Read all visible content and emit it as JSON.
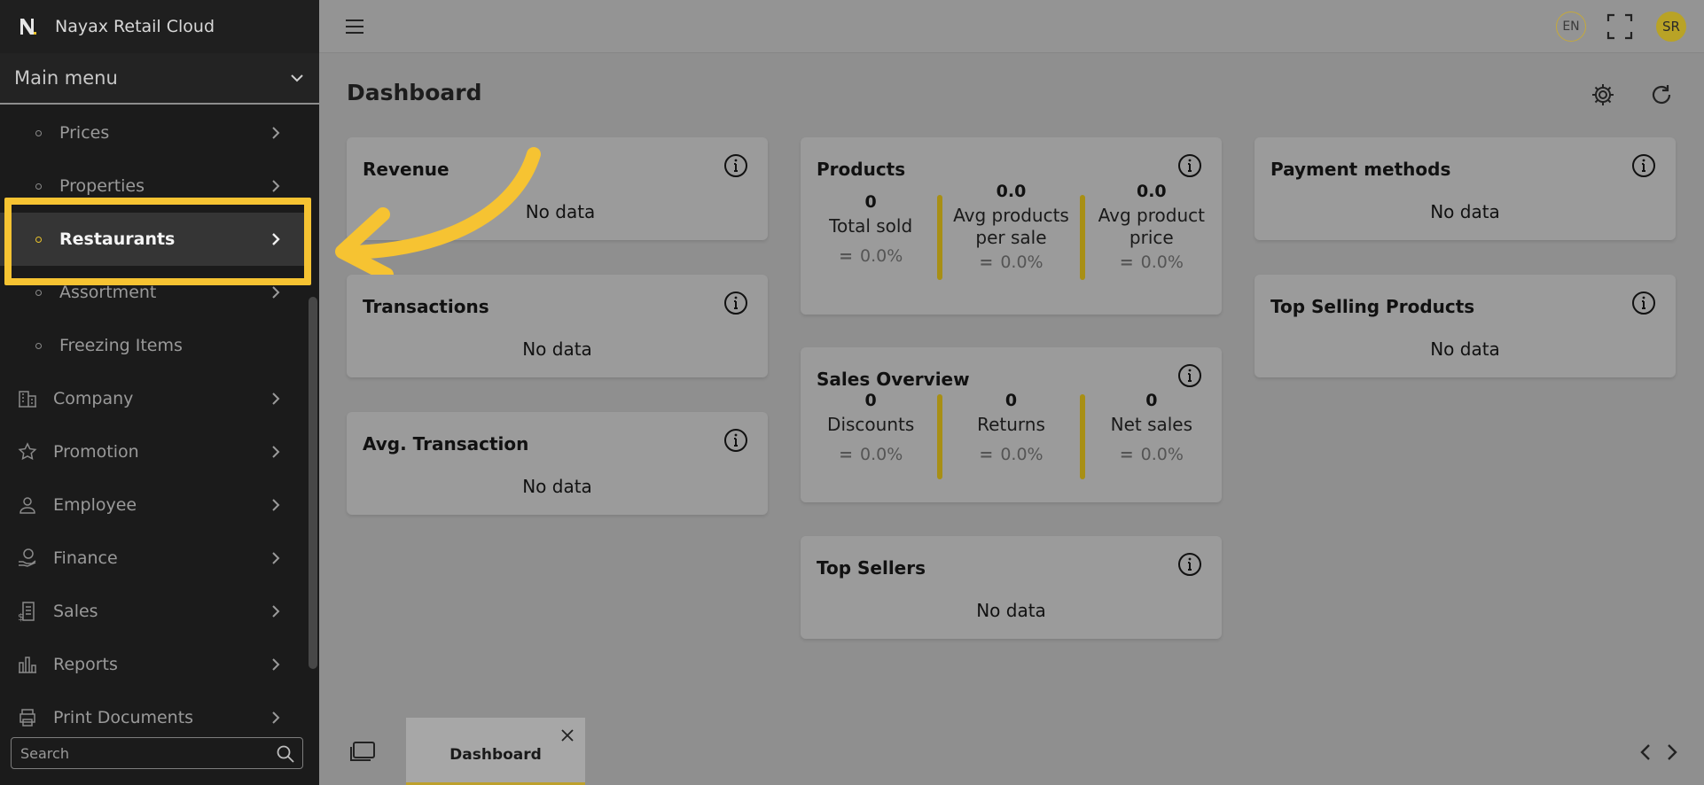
{
  "app": {
    "title": "Nayax Retail Cloud"
  },
  "sidebar": {
    "main_menu_label": "Main menu",
    "items": [
      {
        "label": "Prices",
        "kind": "sub"
      },
      {
        "label": "Properties",
        "kind": "sub"
      },
      {
        "label": "Restaurants",
        "kind": "sub",
        "active": true
      },
      {
        "label": "Assortment",
        "kind": "sub"
      },
      {
        "label": "Freezing Items",
        "kind": "sub"
      },
      {
        "label": "Company",
        "kind": "top",
        "icon": "building-icon"
      },
      {
        "label": "Promotion",
        "kind": "top",
        "icon": "star-icon"
      },
      {
        "label": "Employee",
        "kind": "top",
        "icon": "person-icon"
      },
      {
        "label": "Finance",
        "kind": "top",
        "icon": "money-hand-icon"
      },
      {
        "label": "Sales",
        "kind": "top",
        "icon": "receipt-dollar-icon"
      },
      {
        "label": "Reports",
        "kind": "top",
        "icon": "bar-chart-icon"
      },
      {
        "label": "Print Documents",
        "kind": "top",
        "icon": "printer-icon"
      }
    ],
    "search": {
      "placeholder": "Search"
    }
  },
  "topbar": {
    "language": "EN",
    "avatar_initials": "SR"
  },
  "page": {
    "title": "Dashboard"
  },
  "cards": {
    "revenue": {
      "title": "Revenue",
      "nodata": "No data"
    },
    "transactions": {
      "title": "Transactions",
      "nodata": "No data"
    },
    "avg_transaction": {
      "title": "Avg. Transaction",
      "nodata": "No data"
    },
    "products": {
      "title": "Products",
      "metrics": [
        {
          "value": "0",
          "label_lines": [
            "Total sold"
          ],
          "percent": "0.0%"
        },
        {
          "value": "0.0",
          "label_lines": [
            "Avg products",
            "per sale"
          ],
          "percent": "0.0%"
        },
        {
          "value": "0.0",
          "label_lines": [
            "Avg product",
            "price"
          ],
          "percent": "0.0%"
        }
      ]
    },
    "sales_overview": {
      "title": "Sales Overview",
      "metrics": [
        {
          "value": "0",
          "label_lines": [
            "Discounts"
          ],
          "percent": "0.0%"
        },
        {
          "value": "0",
          "label_lines": [
            "Returns"
          ],
          "percent": "0.0%"
        },
        {
          "value": "0",
          "label_lines": [
            "Net sales"
          ],
          "percent": "0.0%"
        }
      ]
    },
    "top_sellers": {
      "title": "Top Sellers",
      "nodata": "No data"
    },
    "payment_methods": {
      "title": "Payment methods",
      "nodata": "No data"
    },
    "top_selling_products": {
      "title": "Top Selling Products",
      "nodata": "No data"
    }
  },
  "bottom_tabs": [
    {
      "label": "Dashboard"
    }
  ],
  "colors": {
    "accent": "#f6c332",
    "metric_bar": "#a88f14",
    "sidebar_bg": "#1b1b1b"
  }
}
